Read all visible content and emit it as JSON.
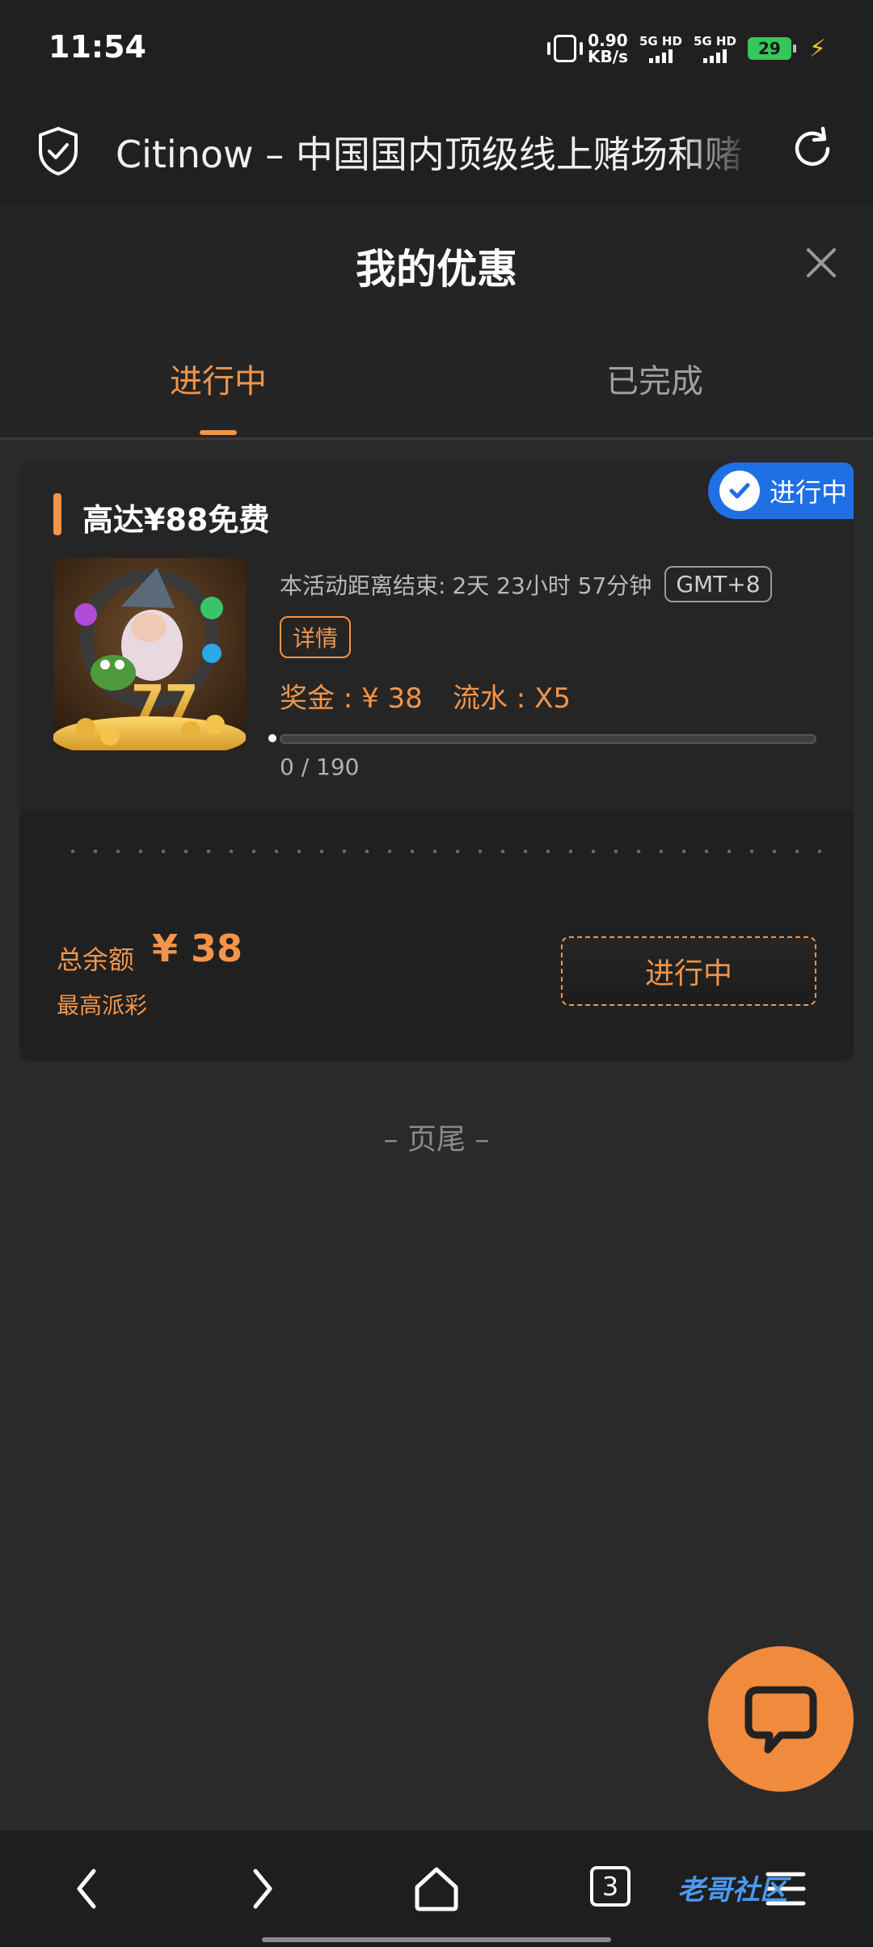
{
  "status_bar": {
    "time": "11:54",
    "net_speed_value": "0.90",
    "net_speed_unit": "KB/s",
    "sim1": "5G HD",
    "sim2": "5G HD",
    "battery": "29"
  },
  "browser": {
    "title": "Citinow – 中国国内顶级线上赌场和赌",
    "tab_count": "3"
  },
  "panel": {
    "title": "我的优惠"
  },
  "tabs": [
    {
      "label": "进行中",
      "active": true
    },
    {
      "label": "已完成",
      "active": false
    }
  ],
  "promo": {
    "status_tag": "进行中",
    "title": "高达¥88免费",
    "countdown_label": "本活动距离结束:",
    "countdown_value": "2天 23小时 57分钟",
    "timezone": "GMT+8",
    "detail_label": "详情",
    "bonus_text": "奖金 : ¥ 38",
    "turnover_text": "流水 : X5",
    "progress_text": "0 / 190",
    "progress_fraction": 0.0,
    "balance_label": "总余额",
    "balance_value": "¥ 38",
    "balance_sub": "最高派彩",
    "cta_label": "进行中"
  },
  "footer": {
    "text": "– 页尾 –"
  },
  "watermark": "老哥社区",
  "colors": {
    "accent": "#f2944a",
    "status_blue": "#1f6fe5",
    "background": "#2a2a2a"
  }
}
